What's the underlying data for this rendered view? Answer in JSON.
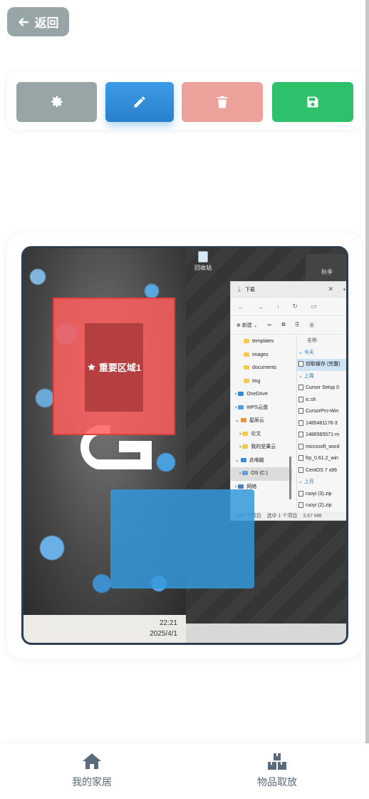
{
  "header": {
    "back_label": "返回",
    "back_icon": "arrow-left-icon"
  },
  "toolbar": {
    "buttons": [
      {
        "name": "settings",
        "icon": "gear-icon",
        "color": "#98a5a6"
      },
      {
        "name": "edit",
        "icon": "pencil-icon",
        "color": "#3498db"
      },
      {
        "name": "delete",
        "icon": "trash-icon",
        "color": "#eca19a"
      },
      {
        "name": "save",
        "icon": "floppy-disk-icon",
        "color": "#2ec06b"
      }
    ]
  },
  "preview": {
    "zones": [
      {
        "label": "重要区域1",
        "color": "#ff5e5e",
        "icon": "star-icon"
      },
      {
        "label": "",
        "color": "#3498db"
      }
    ],
    "screenshot": {
      "recycle_label": "回收站",
      "desktop_icon2": "秋季",
      "clock_time": "22:21",
      "clock_date": "2025/4/1",
      "explorer": {
        "title": "下载",
        "new_label": "新建",
        "sidebar": [
          "templates",
          "images",
          "documents",
          "img",
          "OneDrive",
          "WPS云盘",
          "星辰云",
          "论文",
          "我的坚果云",
          "此电脑",
          "OS (C:)",
          "网络"
        ],
        "column_header": "名称",
        "group_today": "今天",
        "group_earlier": "上周",
        "group_last_month": "上月",
        "files_today": [
          "窃取缓存 (完整)"
        ],
        "files_week": [
          "Cursor Setup 0",
          "ic.sh",
          "CursorPro-Win",
          "1485481176-3",
          "1486565571-m",
          "microsoft_word",
          "frp_0.61.2_win",
          "CentOS 7 x86"
        ],
        "files_month": [
          "ruoyi (3).zip",
          "ruoyi (2).zip"
        ],
        "status_count": "109 个项目",
        "status_selected": "选中 1 个项目",
        "status_size": "3.67 MB"
      }
    }
  },
  "bottom_nav": {
    "items": [
      {
        "label": "我的家居",
        "icon": "home-icon"
      },
      {
        "label": "物品取放",
        "icon": "boxes-icon"
      }
    ]
  }
}
